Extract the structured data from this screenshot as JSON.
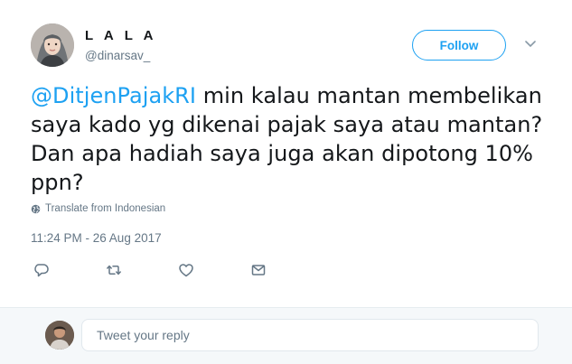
{
  "user": {
    "display_name": "L A L A",
    "handle": "@dinarsav_"
  },
  "header": {
    "follow_label": "Follow"
  },
  "tweet": {
    "mention": "@DitjenPajakRI",
    "body": " min kalau mantan membelikan saya kado yg dikenai pajak saya atau mantan? Dan apa hadiah saya juga akan dipotong 10% ppn?",
    "translate_label": "Translate from Indonesian",
    "timestamp": "11:24 PM - 26 Aug 2017"
  },
  "actions": {
    "icons": [
      "reply-icon",
      "retweet-icon",
      "like-icon",
      "direct-message-icon"
    ]
  },
  "reply": {
    "placeholder": "Tweet your reply"
  },
  "colors": {
    "accent": "#1da1f2",
    "text": "#14171a",
    "secondary": "#657786",
    "reply_bar_bg": "#f5f8fa"
  }
}
